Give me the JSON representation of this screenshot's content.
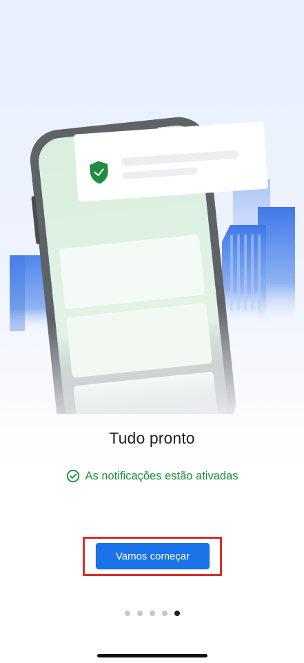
{
  "onboarding": {
    "title": "Tudo pronto",
    "status_text": "As notificações estão ativadas",
    "cta_label": "Vamos começar",
    "page_indicator": {
      "total": 5,
      "current": 5
    }
  },
  "icons": {
    "status": "check-circle-icon",
    "shield": "shield-check-icon"
  },
  "colors": {
    "accent": "#1a73e8",
    "success": "#1e8e3e",
    "highlight_border": "#d93025",
    "text_primary": "#202124"
  }
}
